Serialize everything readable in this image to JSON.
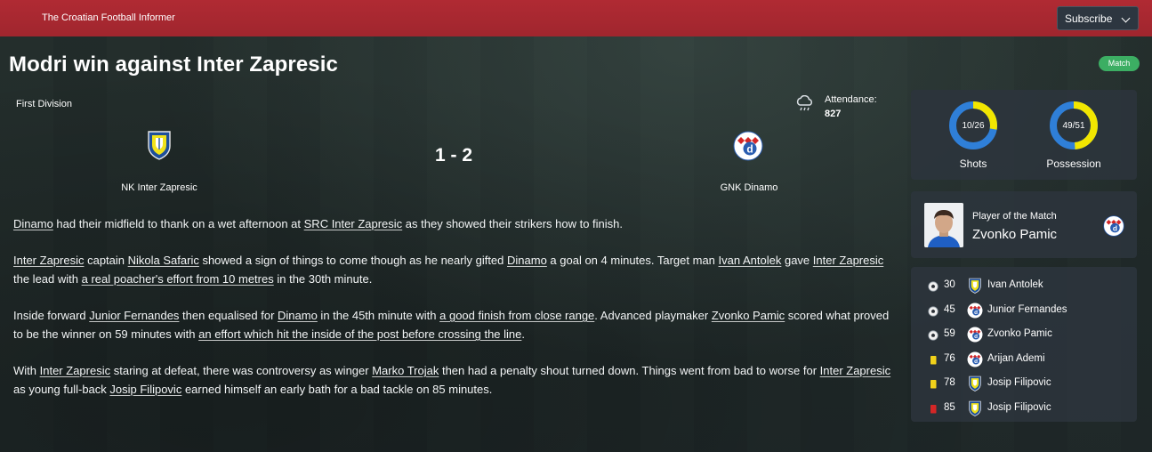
{
  "header": {
    "publisher": "The Croatian Football Informer",
    "subscribe_label": "Subscribe"
  },
  "article": {
    "headline": "Modri win against Inter Zapresic",
    "badge": "Match"
  },
  "match": {
    "competition": "First Division",
    "attendance_label": "Attendance:",
    "attendance_value": "827",
    "home_team": "NK Inter Zapresic",
    "away_team": "GNK Dinamo",
    "score": "1 - 2",
    "weather_icon": "rain-cloud-icon"
  },
  "report": {
    "paragraphs": [
      [
        {
          "t": "Dinamo",
          "link": true
        },
        {
          "t": " had their midfield to thank on a wet afternoon at "
        },
        {
          "t": "SRC Inter Zapresic",
          "link": true
        },
        {
          "t": " as they showed their strikers how to finish."
        }
      ],
      [
        {
          "t": "Inter Zapresic",
          "link": true
        },
        {
          "t": " captain "
        },
        {
          "t": "Nikola Safaric",
          "link": true
        },
        {
          "t": " showed a sign of things to come though as he nearly gifted "
        },
        {
          "t": "Dinamo",
          "link": true
        },
        {
          "t": " a goal on 4 minutes. Target man "
        },
        {
          "t": "Ivan Antolek",
          "link": true
        },
        {
          "t": " gave "
        },
        {
          "t": "Inter Zapresic",
          "link": true
        },
        {
          "t": " the lead with "
        },
        {
          "t": "a real poacher's effort from 10 metres",
          "link": true
        },
        {
          "t": " in the 30th minute."
        }
      ],
      [
        {
          "t": "Inside forward "
        },
        {
          "t": "Junior Fernandes",
          "link": true
        },
        {
          "t": " then equalised for "
        },
        {
          "t": "Dinamo",
          "link": true
        },
        {
          "t": " in the 45th minute with "
        },
        {
          "t": "a good finish from close range",
          "link": true
        },
        {
          "t": ". Advanced playmaker "
        },
        {
          "t": "Zvonko Pamic",
          "link": true
        },
        {
          "t": " scored what proved to be the winner on 59 minutes with "
        },
        {
          "t": "an effort which hit the inside of the post before crossing the line",
          "link": true
        },
        {
          "t": "."
        }
      ],
      [
        {
          "t": "With "
        },
        {
          "t": "Inter Zapresic",
          "link": true
        },
        {
          "t": " staring at defeat, there was controversy as winger "
        },
        {
          "t": "Marko Trojak",
          "link": true
        },
        {
          "t": " then had a penalty shout turned down. Things went from bad to worse for "
        },
        {
          "t": "Inter Zapresic",
          "link": true
        },
        {
          "t": " as young full-back "
        },
        {
          "t": "Josip Filipovic",
          "link": true
        },
        {
          "t": " earned himself an early bath for a bad tackle on 85 minutes."
        }
      ]
    ]
  },
  "stats": [
    {
      "name": "Shots",
      "label": "10/26",
      "home": 10,
      "away": 26
    },
    {
      "name": "Possession",
      "label": "49/51",
      "home": 49,
      "away": 51
    }
  ],
  "player_of_match": {
    "title": "Player of the Match",
    "name": "Zvonko Pamic",
    "team_crest": "dinamo-crest-icon"
  },
  "events": [
    {
      "type": "goal",
      "icon": "football-icon",
      "minute": "30",
      "team": "home",
      "player": "Ivan Antolek"
    },
    {
      "type": "goal",
      "icon": "football-icon",
      "minute": "45",
      "team": "away",
      "player": "Junior Fernandes"
    },
    {
      "type": "goal",
      "icon": "football-icon",
      "minute": "59",
      "team": "away",
      "player": "Zvonko Pamic"
    },
    {
      "type": "yellow",
      "icon": "yellow-card-icon",
      "minute": "76",
      "team": "away",
      "player": "Arijan Ademi"
    },
    {
      "type": "yellow",
      "icon": "yellow-card-icon",
      "minute": "78",
      "team": "home",
      "player": "Josip Filipovic"
    },
    {
      "type": "red",
      "icon": "red-card-icon",
      "minute": "85",
      "team": "home",
      "player": "Josip Filipovic"
    }
  ],
  "colors": {
    "header_red": "#a0262e",
    "home_yellow": "#f2e600",
    "away_blue": "#2f7fd8",
    "badge_green": "#3cae63",
    "yellow_card": "#f2d21a",
    "red_card": "#d42626"
  }
}
